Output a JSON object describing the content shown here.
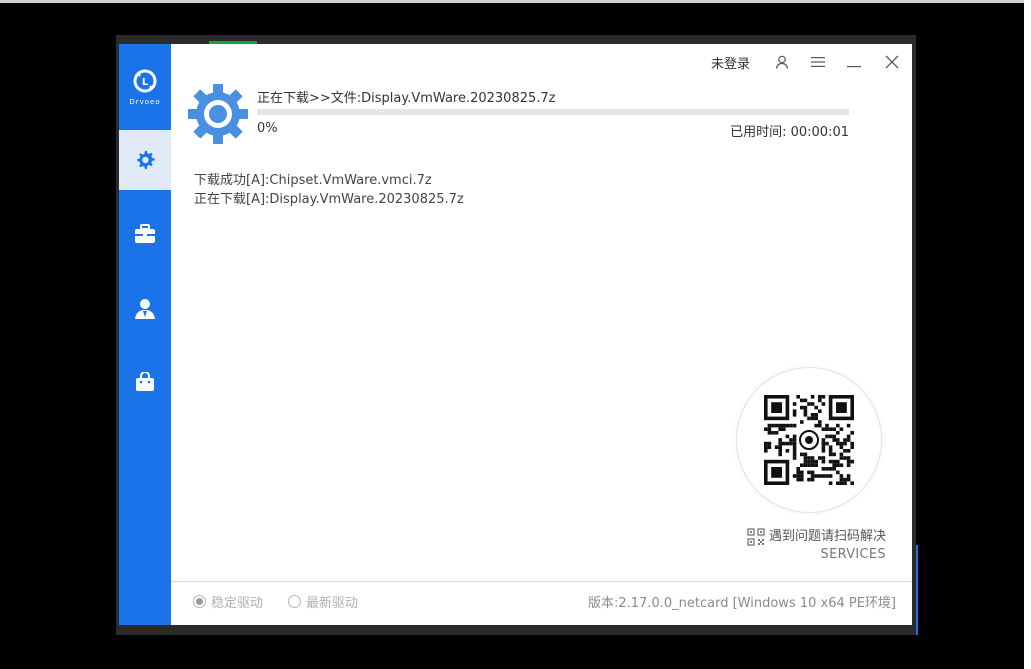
{
  "window": {
    "logo_text": "Drvoeo",
    "login_label": "未登录"
  },
  "sidebar": {
    "items": [
      {
        "name": "driver",
        "icon": "gear-icon",
        "active": true
      },
      {
        "name": "toolbox",
        "icon": "toolbox-icon",
        "active": false
      },
      {
        "name": "user",
        "icon": "person-icon",
        "active": false
      },
      {
        "name": "store",
        "icon": "bag-icon",
        "active": false
      }
    ]
  },
  "download": {
    "title": "正在下载>>文件:Display.VmWare.20230825.7z",
    "progress": 0,
    "percent_text": "0%",
    "elapsed_text": "已用时间: 00:00:01"
  },
  "log": [
    "下载成功[A]:Chipset.VmWare.vmci.7z",
    "正在下载[A]:Display.VmWare.20230825.7z"
  ],
  "support": {
    "qr_label": "遇到问题请扫码解决",
    "services": "SERVICES"
  },
  "footer": {
    "radio_stable": "稳定驱动",
    "radio_latest": "最新驱动",
    "selected": "stable",
    "version": "版本:2.17.0.0_netcard [Windows 10 x64 PE环境]"
  },
  "colors": {
    "accent": "#1a73e8",
    "sidebar_active_bg": "#dfe9f8",
    "gear": "#4a90e2"
  }
}
